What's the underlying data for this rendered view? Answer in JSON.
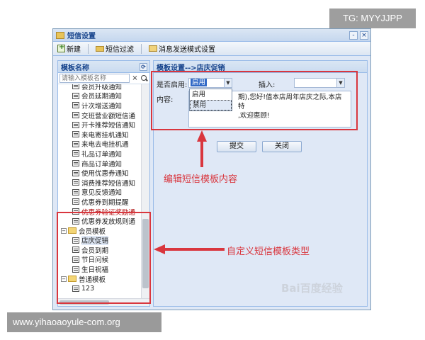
{
  "badges": {
    "tg": "TG: MYYJJPP",
    "site": "www.yihaoaoyule-com.org"
  },
  "window": {
    "title": "短信设置",
    "minimize_label": "-",
    "close_label": "×"
  },
  "toolbar": {
    "new_label": "新建",
    "filter_label": "短信过滤",
    "mode_label": "消息发送模式设置"
  },
  "left_panel": {
    "title": "模板名称",
    "refresh_icon": "refresh-icon",
    "search": {
      "placeholder": "请输入模板名称",
      "clear_label": "×"
    },
    "items_top": [
      {
        "label": "会员升级通知",
        "strike": false
      },
      {
        "label": "会员延期通知",
        "strike": false
      },
      {
        "label": "计次增送通知",
        "strike": false
      },
      {
        "label": "交班营业额短信通",
        "strike": false
      },
      {
        "label": "开卡推荐短信通知",
        "strike": false
      },
      {
        "label": "来电寄挂机通知",
        "strike": false
      },
      {
        "label": "来电去电挂机通",
        "strike": false
      },
      {
        "label": "礼品订单通知",
        "strike": false
      },
      {
        "label": "商品订单通知",
        "strike": false
      },
      {
        "label": "使用优惠券通知",
        "strike": false
      },
      {
        "label": "消费推荐短信通知",
        "strike": false
      },
      {
        "label": "意见反馈通知",
        "strike": false
      },
      {
        "label": "优惠券到期提醒",
        "strike": false
      },
      {
        "label": "优惠券验证奖励通",
        "strike": true
      },
      {
        "label": "优惠券发放规则通",
        "strike": false
      }
    ],
    "group_member": {
      "label": "会员模板",
      "toggle": "−",
      "items": [
        "店庆促销",
        "会员到期",
        "节日问候",
        "生日祝福"
      ],
      "selected_index": 0
    },
    "group_normal": {
      "label": "普通模板",
      "toggle": "−",
      "items": [
        "123"
      ]
    }
  },
  "right_panel": {
    "breadcrumb": "模板设置-->店庆促销",
    "enabled_label": "是否启用:",
    "enabled_value": "启用",
    "enabled_options": [
      "启用",
      "禁用"
    ],
    "insert_label": "插入:",
    "insert_value": "",
    "content_label": "内容:",
    "content_lines": [
      "期),您好!值本店周年店庆之际,本店特",
      ",欢迎惠顾!"
    ],
    "submit_label": "提交",
    "close_label": "关闭"
  },
  "annotations": {
    "edit": "编辑短信模板内容",
    "custom": "自定义短信模板类型",
    "color": "#d9363e"
  },
  "watermark": "Bai百度经验"
}
